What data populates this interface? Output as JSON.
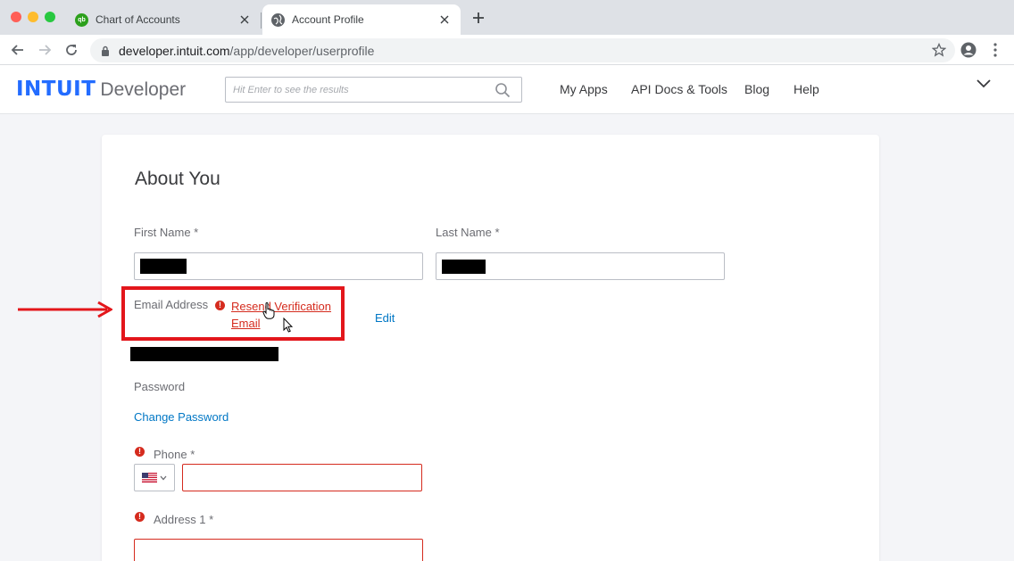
{
  "browser": {
    "tabs": [
      {
        "title": "Chart of Accounts",
        "favicon": "quickbooks-icon",
        "active": false
      },
      {
        "title": "Account Profile",
        "favicon": "globe-icon",
        "active": true
      }
    ],
    "url_host": "developer.intuit.com",
    "url_path": "/app/developer/userprofile"
  },
  "site": {
    "logo_brand": "INTUIT",
    "logo_product": "Developer",
    "search_placeholder": "Hit Enter to see the results",
    "nav": [
      "My Apps",
      "API Docs & Tools",
      "Blog",
      "Help"
    ],
    "brand_color": "#236cff"
  },
  "profile": {
    "title": "About You",
    "first_name_label": "First Name *",
    "last_name_label": "Last Name *",
    "email_label": "Email Address",
    "resend_link": "Resend Verification Email",
    "edit_link": "Edit",
    "password_label": "Password",
    "change_password_link": "Change Password",
    "phone_label": "Phone *",
    "phone_country": "US",
    "address1_label": "Address 1 *",
    "error_icon": "!",
    "error_color": "#d52b1e",
    "link_color": "#0077c5"
  },
  "annotation": {
    "highlight_color": "#e3161b"
  }
}
